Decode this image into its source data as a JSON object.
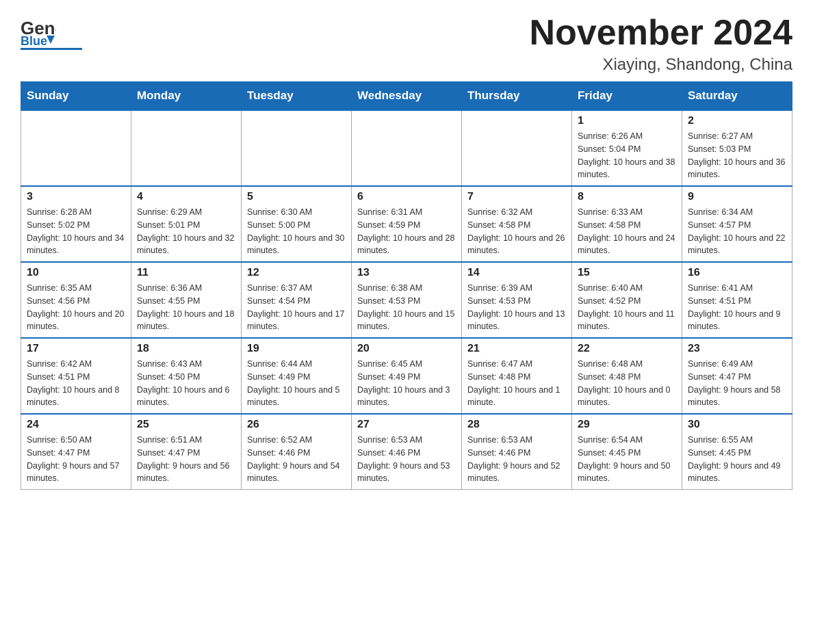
{
  "header": {
    "logo_general": "General",
    "logo_blue": "Blue",
    "month_title": "November 2024",
    "location": "Xiaying, Shandong, China"
  },
  "weekdays": [
    "Sunday",
    "Monday",
    "Tuesday",
    "Wednesday",
    "Thursday",
    "Friday",
    "Saturday"
  ],
  "weeks": [
    [
      {
        "day": "",
        "info": ""
      },
      {
        "day": "",
        "info": ""
      },
      {
        "day": "",
        "info": ""
      },
      {
        "day": "",
        "info": ""
      },
      {
        "day": "",
        "info": ""
      },
      {
        "day": "1",
        "info": "Sunrise: 6:26 AM\nSunset: 5:04 PM\nDaylight: 10 hours and 38 minutes."
      },
      {
        "day": "2",
        "info": "Sunrise: 6:27 AM\nSunset: 5:03 PM\nDaylight: 10 hours and 36 minutes."
      }
    ],
    [
      {
        "day": "3",
        "info": "Sunrise: 6:28 AM\nSunset: 5:02 PM\nDaylight: 10 hours and 34 minutes."
      },
      {
        "day": "4",
        "info": "Sunrise: 6:29 AM\nSunset: 5:01 PM\nDaylight: 10 hours and 32 minutes."
      },
      {
        "day": "5",
        "info": "Sunrise: 6:30 AM\nSunset: 5:00 PM\nDaylight: 10 hours and 30 minutes."
      },
      {
        "day": "6",
        "info": "Sunrise: 6:31 AM\nSunset: 4:59 PM\nDaylight: 10 hours and 28 minutes."
      },
      {
        "day": "7",
        "info": "Sunrise: 6:32 AM\nSunset: 4:58 PM\nDaylight: 10 hours and 26 minutes."
      },
      {
        "day": "8",
        "info": "Sunrise: 6:33 AM\nSunset: 4:58 PM\nDaylight: 10 hours and 24 minutes."
      },
      {
        "day": "9",
        "info": "Sunrise: 6:34 AM\nSunset: 4:57 PM\nDaylight: 10 hours and 22 minutes."
      }
    ],
    [
      {
        "day": "10",
        "info": "Sunrise: 6:35 AM\nSunset: 4:56 PM\nDaylight: 10 hours and 20 minutes."
      },
      {
        "day": "11",
        "info": "Sunrise: 6:36 AM\nSunset: 4:55 PM\nDaylight: 10 hours and 18 minutes."
      },
      {
        "day": "12",
        "info": "Sunrise: 6:37 AM\nSunset: 4:54 PM\nDaylight: 10 hours and 17 minutes."
      },
      {
        "day": "13",
        "info": "Sunrise: 6:38 AM\nSunset: 4:53 PM\nDaylight: 10 hours and 15 minutes."
      },
      {
        "day": "14",
        "info": "Sunrise: 6:39 AM\nSunset: 4:53 PM\nDaylight: 10 hours and 13 minutes."
      },
      {
        "day": "15",
        "info": "Sunrise: 6:40 AM\nSunset: 4:52 PM\nDaylight: 10 hours and 11 minutes."
      },
      {
        "day": "16",
        "info": "Sunrise: 6:41 AM\nSunset: 4:51 PM\nDaylight: 10 hours and 9 minutes."
      }
    ],
    [
      {
        "day": "17",
        "info": "Sunrise: 6:42 AM\nSunset: 4:51 PM\nDaylight: 10 hours and 8 minutes."
      },
      {
        "day": "18",
        "info": "Sunrise: 6:43 AM\nSunset: 4:50 PM\nDaylight: 10 hours and 6 minutes."
      },
      {
        "day": "19",
        "info": "Sunrise: 6:44 AM\nSunset: 4:49 PM\nDaylight: 10 hours and 5 minutes."
      },
      {
        "day": "20",
        "info": "Sunrise: 6:45 AM\nSunset: 4:49 PM\nDaylight: 10 hours and 3 minutes."
      },
      {
        "day": "21",
        "info": "Sunrise: 6:47 AM\nSunset: 4:48 PM\nDaylight: 10 hours and 1 minute."
      },
      {
        "day": "22",
        "info": "Sunrise: 6:48 AM\nSunset: 4:48 PM\nDaylight: 10 hours and 0 minutes."
      },
      {
        "day": "23",
        "info": "Sunrise: 6:49 AM\nSunset: 4:47 PM\nDaylight: 9 hours and 58 minutes."
      }
    ],
    [
      {
        "day": "24",
        "info": "Sunrise: 6:50 AM\nSunset: 4:47 PM\nDaylight: 9 hours and 57 minutes."
      },
      {
        "day": "25",
        "info": "Sunrise: 6:51 AM\nSunset: 4:47 PM\nDaylight: 9 hours and 56 minutes."
      },
      {
        "day": "26",
        "info": "Sunrise: 6:52 AM\nSunset: 4:46 PM\nDaylight: 9 hours and 54 minutes."
      },
      {
        "day": "27",
        "info": "Sunrise: 6:53 AM\nSunset: 4:46 PM\nDaylight: 9 hours and 53 minutes."
      },
      {
        "day": "28",
        "info": "Sunrise: 6:53 AM\nSunset: 4:46 PM\nDaylight: 9 hours and 52 minutes."
      },
      {
        "day": "29",
        "info": "Sunrise: 6:54 AM\nSunset: 4:45 PM\nDaylight: 9 hours and 50 minutes."
      },
      {
        "day": "30",
        "info": "Sunrise: 6:55 AM\nSunset: 4:45 PM\nDaylight: 9 hours and 49 minutes."
      }
    ]
  ]
}
